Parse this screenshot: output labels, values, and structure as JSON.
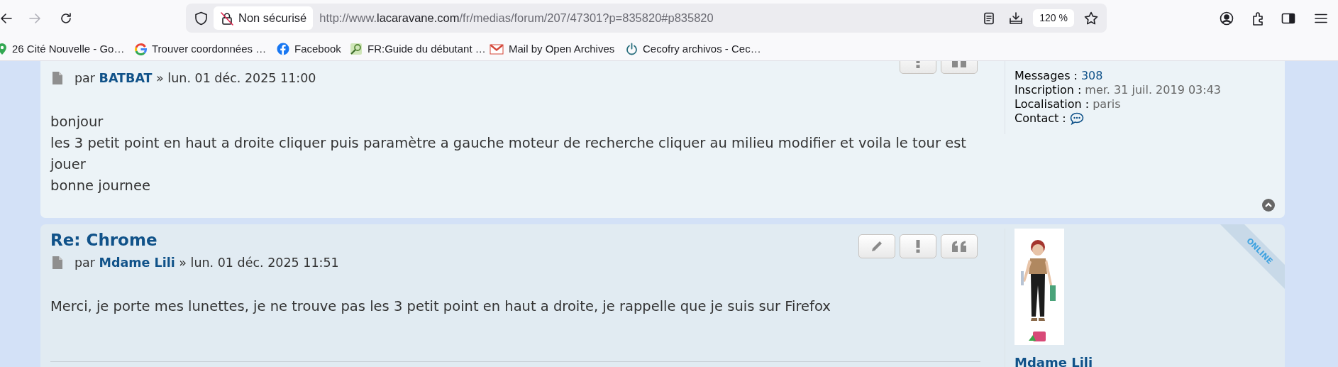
{
  "browser": {
    "security_label": "Non sécurisé",
    "url": {
      "start": "http://www.",
      "domain": "lacaravane.com",
      "path": "/fr/medias/forum/207/47301?p=835820#p835820"
    },
    "zoom": "120 %",
    "bookmarks": [
      {
        "label": "26 Cité Nouvelle - Go…",
        "kind": "pin"
      },
      {
        "label": "Trouver coordonnées …",
        "kind": "google"
      },
      {
        "label": "Facebook",
        "kind": "facebook"
      },
      {
        "label": "FR:Guide du débutant …",
        "kind": "guide"
      },
      {
        "label": "Mail by Open Archives",
        "kind": "mail"
      },
      {
        "label": "Cecofry archivos - Cec…",
        "kind": "power"
      }
    ]
  },
  "posts": [
    {
      "byline": {
        "by": "par",
        "author": "BATBAT",
        "date": "» lun. 01 déc. 2025 11:00"
      },
      "buttons": [
        {
          "kind": "report"
        },
        {
          "kind": "quote"
        }
      ],
      "body": [
        "bonjour",
        "les 3 petit point en haut a droite cliquer puis paramètre a gauche moteur de recherche cliquer au milieu modifier et voila le tour est jouer",
        "bonne journee"
      ],
      "profile": [
        {
          "label": "Messages :",
          "value": "308",
          "kind": "link"
        },
        {
          "label": "Inscription :",
          "value": "mer. 31 juil. 2019 03:43",
          "kind": "text"
        },
        {
          "label": "Localisation :",
          "value": "paris",
          "kind": "text"
        },
        {
          "label": "Contact :",
          "kind": "contact"
        }
      ],
      "back_to_top": true
    },
    {
      "title": "Re: Chrome",
      "byline": {
        "by": "par",
        "author": "Mdame Lili",
        "date": "» lun. 01 déc. 2025 11:51"
      },
      "buttons": [
        {
          "kind": "edit"
        },
        {
          "kind": "report"
        },
        {
          "kind": "quote"
        }
      ],
      "body": [
        "Merci, je porte mes lunettes, je ne trouve pas les 3 petit point en haut a droite, je rappelle que je suis sur Firefox"
      ],
      "avatar": {
        "kind": "picture"
      },
      "author_name": "Mdame Lili",
      "online_badge": "ONLINE"
    }
  ]
}
